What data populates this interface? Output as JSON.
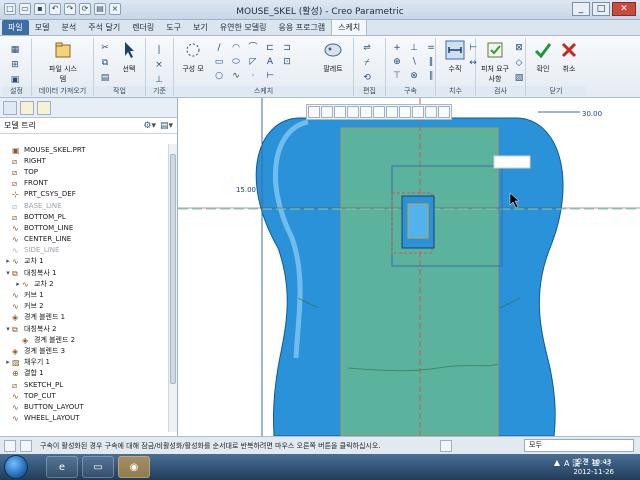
{
  "window": {
    "title": "MOUSE_SKEL (활성) - Creo Parametric"
  },
  "tabs": [
    {
      "label": "파일",
      "state": "file"
    },
    {
      "label": "모델"
    },
    {
      "label": "분석"
    },
    {
      "label": "주석 달기"
    },
    {
      "label": "렌더링"
    },
    {
      "label": "도구"
    },
    {
      "label": "보기"
    },
    {
      "label": "유연한 모델링"
    },
    {
      "label": "응용 프로그램"
    },
    {
      "label": "스케치",
      "state": "active"
    }
  ],
  "ribbon": {
    "file_system": "파일 시스템",
    "select": "선택",
    "csys": "구성 모",
    "palette": "팔레트",
    "vertical": "수직",
    "feature_req": "피처 요구사항",
    "ok": "확인",
    "cancel": "취소",
    "groups": {
      "setup": "설정",
      "get_data": "데이터 가져오기",
      "operations": "작업",
      "datum": "기준",
      "sketch": "스케치",
      "edit": "편집",
      "constrain": "구속",
      "dimension": "치수",
      "inspect": "검사",
      "close": "닫기"
    }
  },
  "model_tree": {
    "title": "모델 트리",
    "items": [
      {
        "label": "MOUSE_SKEL.PRT",
        "icon": "part-icon",
        "toggle": ""
      },
      {
        "label": "RIGHT",
        "icon": "datum-plane-icon",
        "toggle": ""
      },
      {
        "label": "TOP",
        "icon": "datum-plane-icon",
        "toggle": ""
      },
      {
        "label": "FRONT",
        "icon": "datum-plane-icon",
        "toggle": ""
      },
      {
        "label": "PRT_CSYS_DEF",
        "icon": "csys-icon",
        "toggle": ""
      },
      {
        "label": "BASE_LINE",
        "icon": "datum-plane-icon",
        "toggle": "",
        "dim": true
      },
      {
        "label": "BOTTOM_PL",
        "icon": "datum-plane-icon",
        "toggle": ""
      },
      {
        "label": "BOTTOM_LINE",
        "icon": "curve-icon",
        "toggle": ""
      },
      {
        "label": "CENTER_LINE",
        "icon": "curve-icon",
        "toggle": ""
      },
      {
        "label": "SIDE_LINE",
        "icon": "curve-icon",
        "toggle": "",
        "dim": true
      },
      {
        "label": "교차 1",
        "icon": "curve-icon",
        "toggle": "▸"
      },
      {
        "label": "대칭복사 1",
        "icon": "mirror-icon",
        "toggle": "▾"
      },
      {
        "label": "교차 2",
        "icon": "curve-icon",
        "toggle": "▸",
        "indent": 1
      },
      {
        "label": "커브 1",
        "icon": "curve-icon",
        "toggle": ""
      },
      {
        "label": "커브 2",
        "icon": "curve-icon",
        "toggle": ""
      },
      {
        "label": "경계 블렌드 1",
        "icon": "blend-icon",
        "toggle": ""
      },
      {
        "label": "대칭복사 2",
        "icon": "mirror-icon",
        "toggle": "▾"
      },
      {
        "label": "경계 블렌드 2",
        "icon": "blend-icon",
        "toggle": "",
        "indent": 1
      },
      {
        "label": "경계 블렌드 3",
        "icon": "blend-icon",
        "toggle": ""
      },
      {
        "label": "채우기 1",
        "icon": "fill-icon",
        "toggle": "▸"
      },
      {
        "label": "결합 1",
        "icon": "merge-icon",
        "toggle": ""
      },
      {
        "label": "SKETCH_PL",
        "icon": "datum-plane-icon",
        "toggle": ""
      },
      {
        "label": "TOP_CUT",
        "icon": "curve-icon",
        "toggle": ""
      },
      {
        "label": "BUTTON_LAYOUT",
        "icon": "curve-icon",
        "toggle": ""
      },
      {
        "label": "WHEEL_LAYOUT",
        "icon": "curve-icon",
        "toggle": ""
      }
    ]
  },
  "canvas": {
    "dim_left": "15.00",
    "dim_right": "30.00"
  },
  "status": {
    "message": "구속이 활성화된 경우 구속에 대해 잠금/비활성화/활성화를 순서대로 반복하려면 마우스 오른쪽 버튼을 클릭하십시오.",
    "filter": "모두"
  },
  "taskbar": {
    "time": "오전 10:43",
    "date": "2012-11-26",
    "ime": "A 漢"
  },
  "colors": {
    "part_blue": "#2a92d8",
    "sketch_green": "#6dbf8a",
    "accent": "#3b6ea5"
  }
}
